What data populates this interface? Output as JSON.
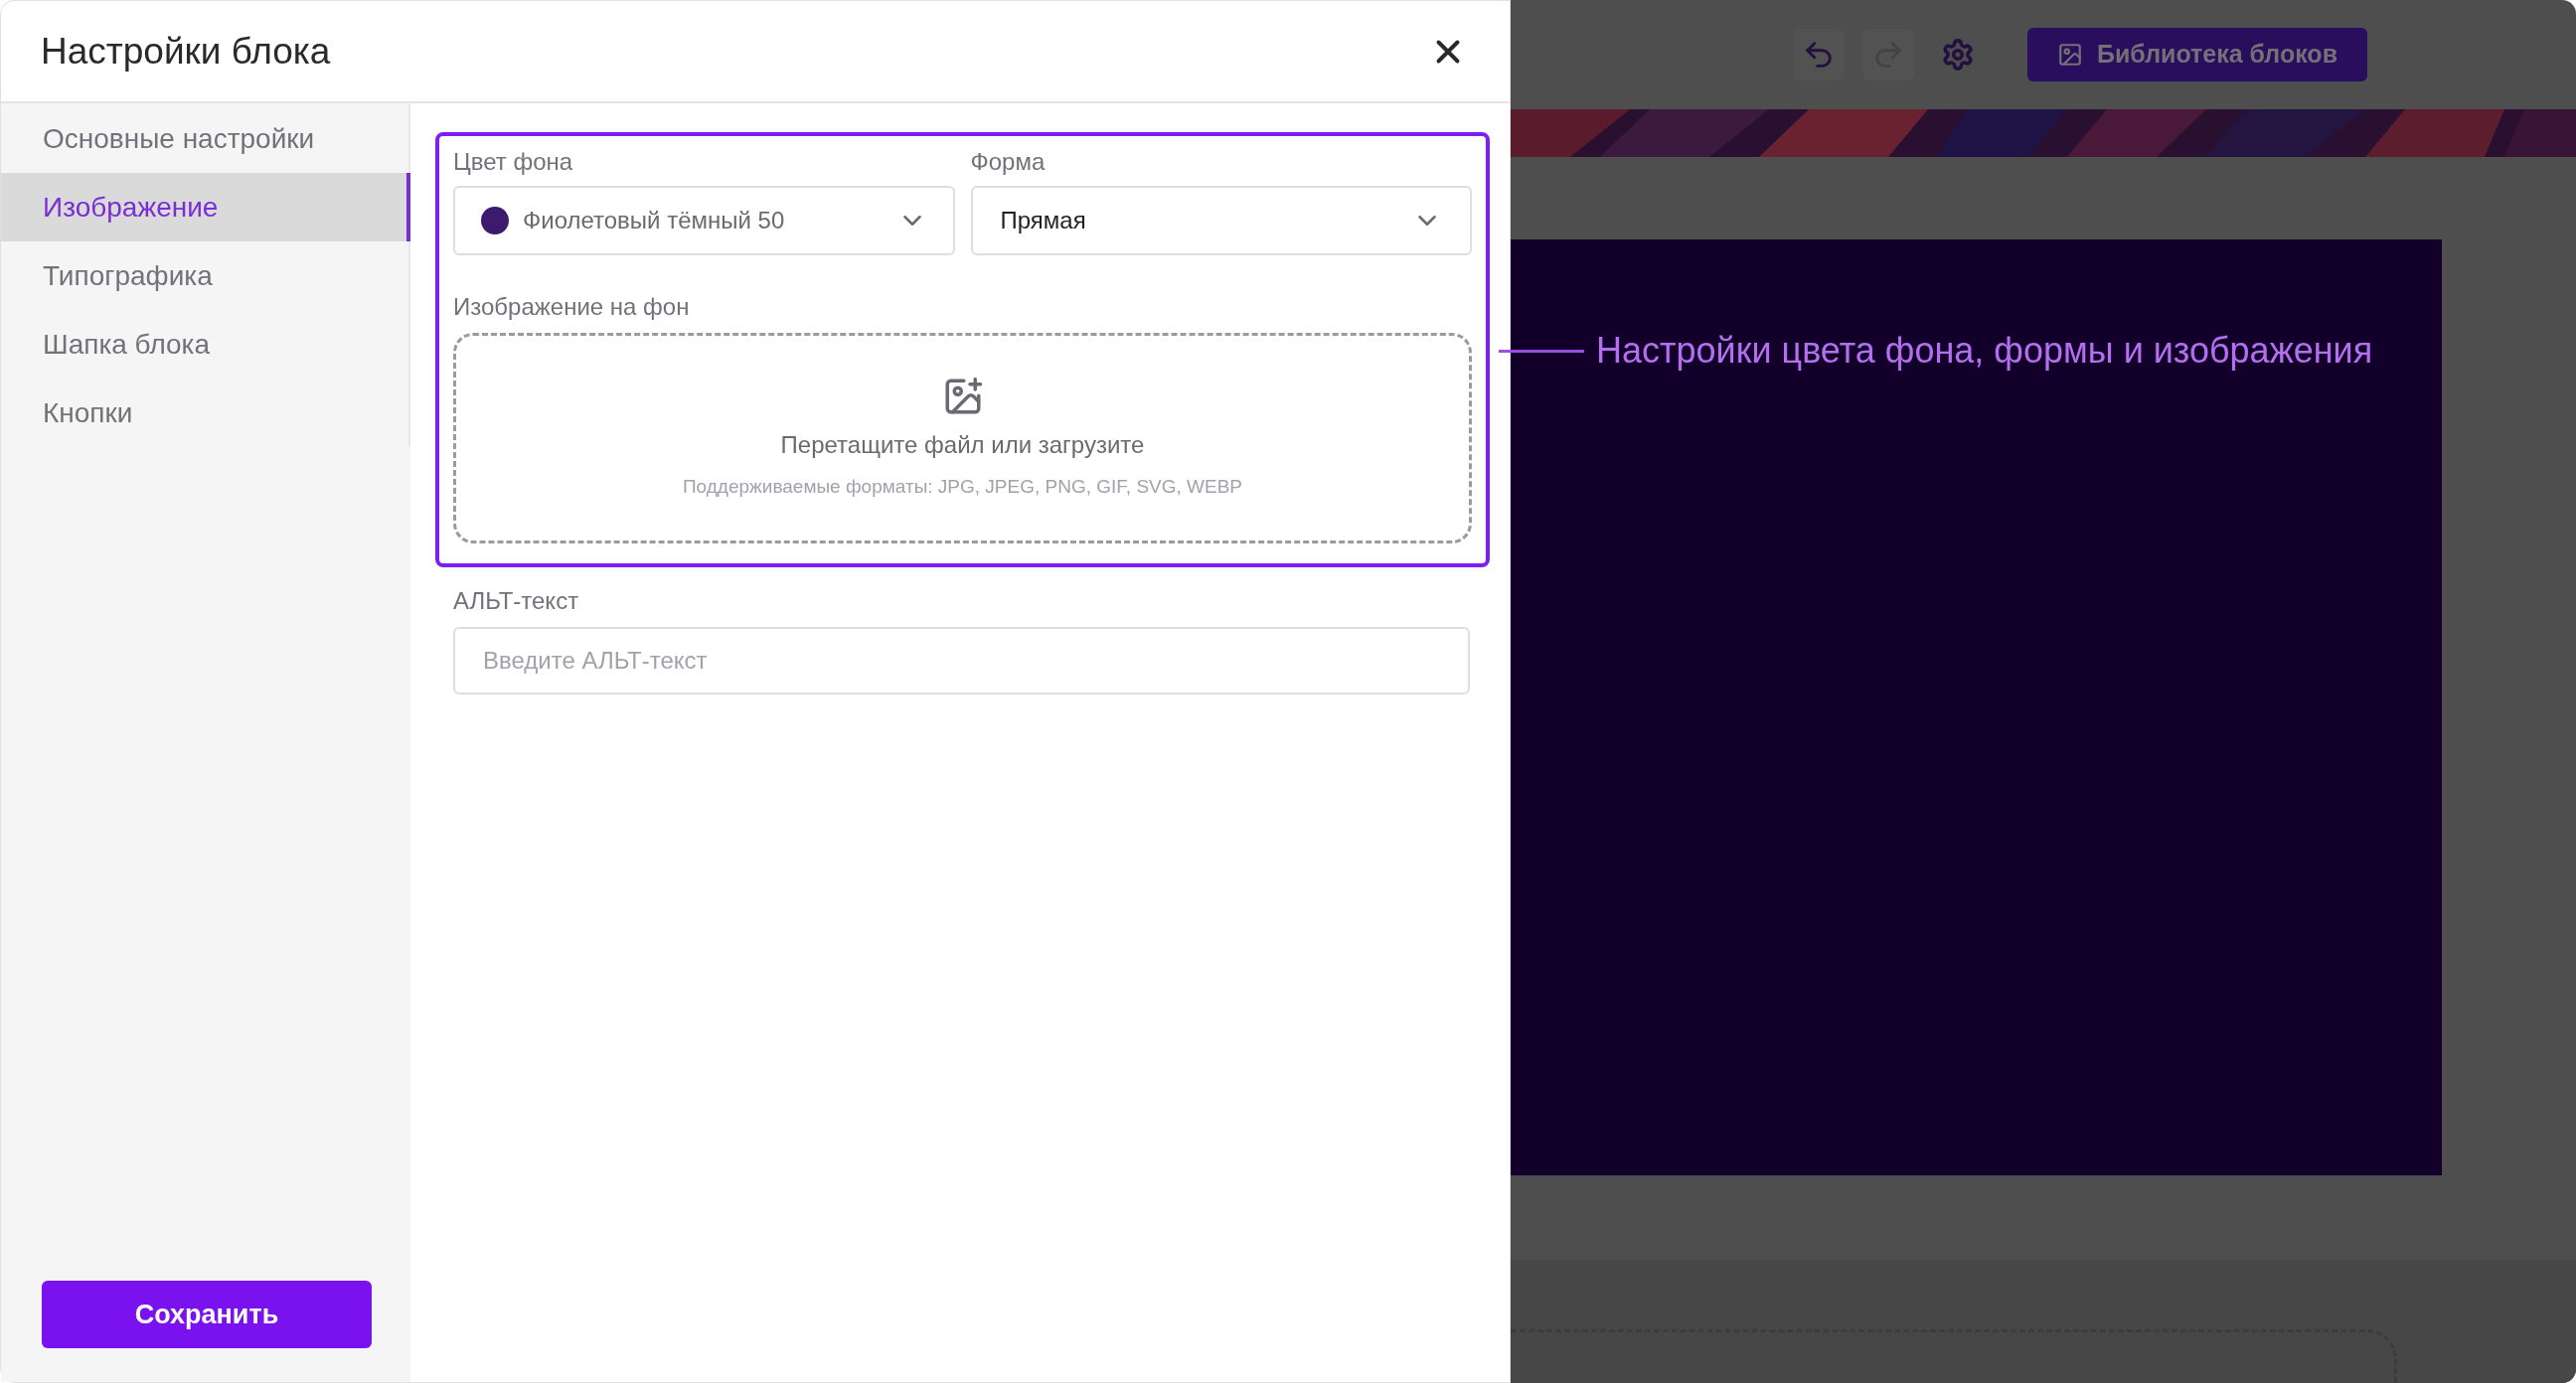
{
  "dialog": {
    "title": "Настройки блока"
  },
  "sidebar": {
    "items": [
      {
        "label": "Основные настройки",
        "selected": false
      },
      {
        "label": "Изображение",
        "selected": true
      },
      {
        "label": "Типографика",
        "selected": false
      },
      {
        "label": "Шапка блока",
        "selected": false
      },
      {
        "label": "Кнопки",
        "selected": false
      }
    ]
  },
  "form": {
    "background_color": {
      "label": "Цвет фона",
      "value": "Фиолетовый тёмный 50"
    },
    "shape": {
      "label": "Форма",
      "value": "Прямая"
    },
    "image": {
      "label": "Изображение на фон",
      "hint": "Перетащите файл или загрузите",
      "formats": "Поддерживаемые форматы: JPG, JPEG, PNG, GIF, SVG, WEBP"
    },
    "alt_text": {
      "label": "АЛЬТ-текст",
      "placeholder": "Введите АЛЬТ-текст"
    }
  },
  "save_button": "Сохранить",
  "editor": {
    "toolbar": [
      {
        "kind": "undo",
        "disabled": false
      },
      {
        "kind": "redo",
        "disabled": true
      },
      {
        "kind": "settings",
        "disabled": false
      }
    ],
    "library_button": "Библиотека блоков"
  },
  "annotation": "Настройки цвета фона, формы и изображения"
}
